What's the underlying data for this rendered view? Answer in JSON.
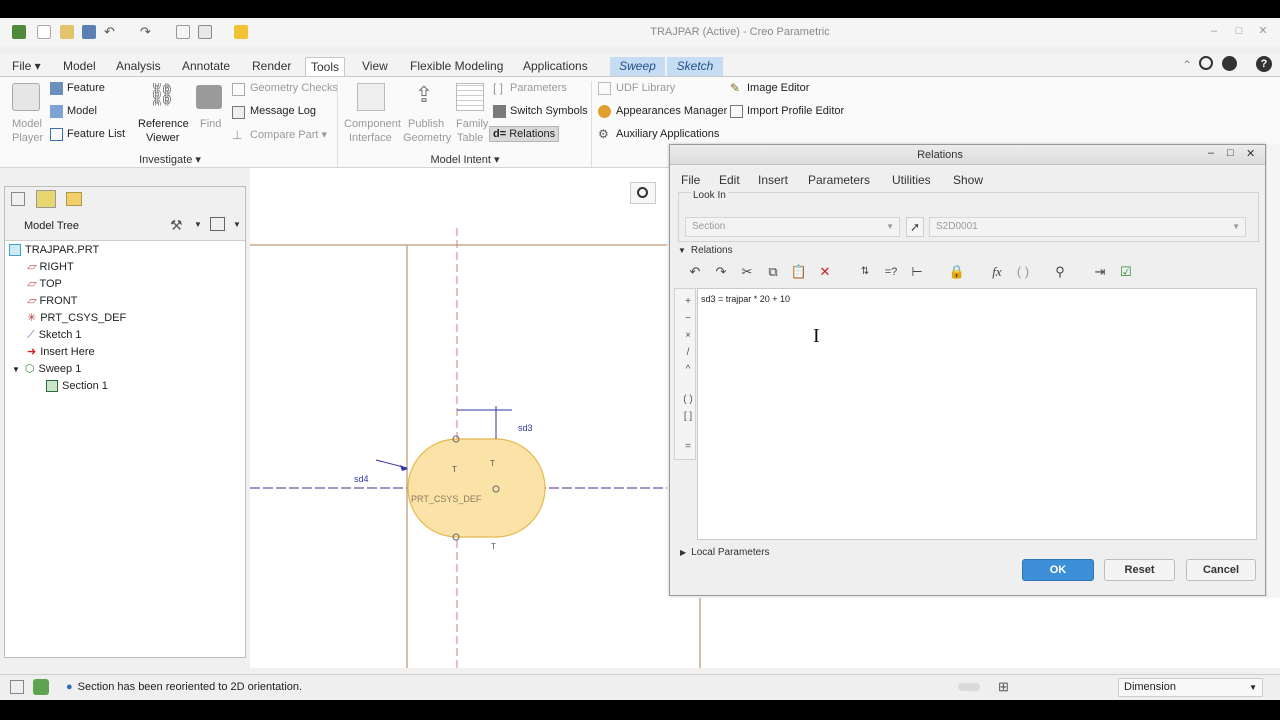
{
  "window": {
    "title": "TRAJPAR (Active) - Creo Parametric"
  },
  "menu_tabs": [
    {
      "label": "File",
      "id": "file"
    },
    {
      "label": "Model",
      "id": "model"
    },
    {
      "label": "Analysis",
      "id": "analysis"
    },
    {
      "label": "Annotate",
      "id": "annotate"
    },
    {
      "label": "Render",
      "id": "render"
    },
    {
      "label": "Tools",
      "id": "tools"
    },
    {
      "label": "View",
      "id": "view"
    },
    {
      "label": "Flexible Modeling",
      "id": "flexible-modeling"
    },
    {
      "label": "Applications",
      "id": "applications"
    },
    {
      "label": "Sweep",
      "id": "sweep"
    },
    {
      "label": "Sketch",
      "id": "sketch"
    }
  ],
  "ribbon": {
    "model_player_1": "Model",
    "model_player_2": "Player",
    "feature": "Feature",
    "model": "Model",
    "feature_list": "Feature List",
    "reference_viewer_1": "Reference",
    "reference_viewer_2": "Viewer",
    "find": "Find",
    "geometry_checks": "Geometry Checks",
    "message_log": "Message Log",
    "compare_part": "Compare Part",
    "group_investigate": "Investigate",
    "component_interface_1": "Component",
    "component_interface_2": "Interface",
    "publish_geometry_1": "Publish",
    "publish_geometry_2": "Geometry",
    "family_table_1": "Family",
    "family_table_2": "Table",
    "parameters": "Parameters",
    "switch_symbols": "Switch Symbols",
    "relations": "Relations",
    "group_model_intent": "Model Intent",
    "udf_library": "UDF Library",
    "appearances_manager": "Appearances Manager",
    "auxiliary_applications": "Auxiliary Applications",
    "image_editor": "Image Editor",
    "import_profile_editor": "Import Profile Editor"
  },
  "model_tree": {
    "title": "Model Tree",
    "items": [
      {
        "label": "TRAJPAR.PRT"
      },
      {
        "label": "RIGHT"
      },
      {
        "label": "TOP"
      },
      {
        "label": "FRONT"
      },
      {
        "label": "PRT_CSYS_DEF"
      },
      {
        "label": "Sketch 1"
      },
      {
        "label": "Insert Here"
      },
      {
        "label": "Sweep 1"
      },
      {
        "label": "Section 1"
      }
    ]
  },
  "graphics": {
    "dim_sd3": "sd3",
    "dim_sd4": "sd4",
    "csys_label": "PRT_CSYS_DEF",
    "constraint_t": "T"
  },
  "relations_dialog": {
    "title": "Relations",
    "menu": [
      "File",
      "Edit",
      "Insert",
      "Parameters",
      "Utilities",
      "Show"
    ],
    "look_in_label": "Look In",
    "look_in_value": "Section",
    "look_in_object": "S2D0001",
    "relations_label": "Relations",
    "relation_text": "sd3 = trajpar * 20 + 10",
    "gutter_symbols": [
      "+",
      "−",
      "×",
      "/",
      "^",
      "( )",
      "[ ]",
      "="
    ],
    "local_parameters_label": "Local Parameters",
    "ok": "OK",
    "reset": "Reset",
    "cancel": "Cancel",
    "toolbar_fx": "fx",
    "toolbar_eval": "=?"
  },
  "statusbar": {
    "message": "Section has been reoriented to 2D orientation.",
    "filter_value": "Dimension"
  },
  "colors": {
    "sweep_tab": "#c6dcf3",
    "section_fill": "#fbe3a8",
    "section_stroke": "#e6b84f",
    "ok_button": "#3d8fd8"
  }
}
